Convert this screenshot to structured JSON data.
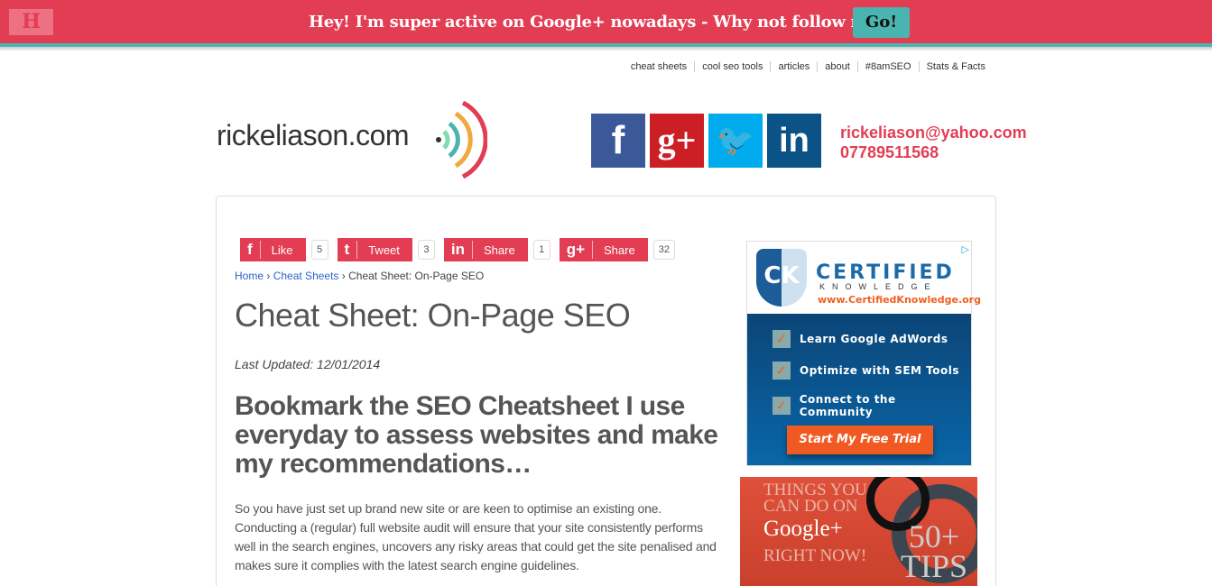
{
  "topbar": {
    "promo": "Hey! I'm super active on Google+ nowadays - Why not follow me?",
    "go_label": "Go!",
    "logo_letter": "H",
    "colors": {
      "bar": "#e33d54",
      "accent": "#4ab5b0"
    }
  },
  "nav": [
    "cheat sheets",
    "cool seo tools",
    "articles",
    "about",
    "#8amSEO",
    "Stats & Facts"
  ],
  "header": {
    "logo_text": "rickeliason.com",
    "social": [
      {
        "icon": "facebook-icon",
        "glyph": "f",
        "color": "#3b5998"
      },
      {
        "icon": "google-plus-icon",
        "glyph": "g+",
        "color": "#cc1f25"
      },
      {
        "icon": "twitter-icon",
        "glyph": "🐦",
        "color": "#00aced"
      },
      {
        "icon": "linkedin-icon",
        "glyph": "in",
        "color": "#0b5286"
      }
    ],
    "email": "rickeliason@yahoo.com",
    "phone": "07789511568"
  },
  "shares": [
    {
      "glyph": "f",
      "label": "Like",
      "count": "5"
    },
    {
      "glyph": "t",
      "label": "Tweet",
      "count": "3"
    },
    {
      "glyph": "in",
      "label": "Share",
      "count": "1"
    },
    {
      "glyph": "g+",
      "label": "Share",
      "count": "32"
    }
  ],
  "breadcrumb": {
    "home": "Home",
    "section": "Cheat Sheets",
    "current": "Cheat Sheet: On-Page SEO",
    "sep": "›"
  },
  "article": {
    "title": "Cheat Sheet: On-Page SEO",
    "updated": "Last Updated: 12/01/2014",
    "subtitle": "Bookmark the SEO Cheatsheet I use everyday to assess websites and make my recommendations…",
    "intro": "So you have just set up brand new site or are keen to optimise an existing one. Conducting a (regular) full website audit will ensure that your site consistently performs well in the search engines, uncovers any risky areas that could get the site penalised and makes sure it complies with the latest search engine guidelines."
  },
  "ad1": {
    "logo": "CK",
    "brand": "CERTIFIED",
    "sub": "KNOWLEDGE",
    "url": "www.CertifiedKnowledge.org",
    "items": [
      "Learn Google AdWords",
      "Optimize with SEM Tools",
      "Connect to the Community"
    ],
    "cta": "Start My Free Trial"
  },
  "ad2": {
    "line1": "THINGS YOU",
    "line2": "CAN DO ON",
    "brand": "Google+",
    "line3": "RIGHT NOW!",
    "tips1": "50+",
    "tips2": "TIPS"
  }
}
